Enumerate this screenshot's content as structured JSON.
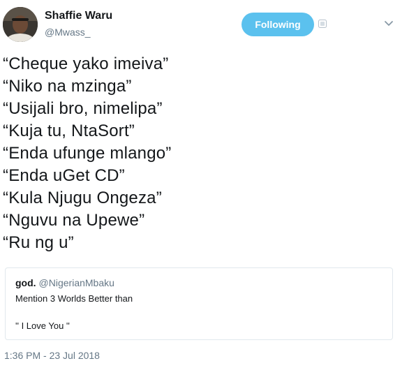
{
  "author": {
    "display_name": "Shaffie Waru",
    "handle": "@Mwass_",
    "avatar": "avatar-photo"
  },
  "follow_button": {
    "label": "Following",
    "color": "#5bc1ee"
  },
  "icons": {
    "mute": "mute-icon",
    "menu": "chevron-down-icon"
  },
  "tweet": {
    "lines": [
      "“Cheque yako imeiva”",
      "“Niko na mzinga”",
      "“Usijali bro, nimelipa”",
      "“Kuja tu, NtaSort”",
      "“Enda ufunge mlango”",
      "“Enda uGet CD”",
      "“Kula Njugu Ongeza”",
      "“Nguvu na Upewe”",
      "“Ru ng u”"
    ]
  },
  "quoted_tweet": {
    "name": "god.",
    "handle": "@NigerianMbaku",
    "lines": [
      "Mention 3 Worlds Better than",
      "'' I Love You ''"
    ]
  },
  "timestamp": "1:36 PM - 23 Jul 2018"
}
